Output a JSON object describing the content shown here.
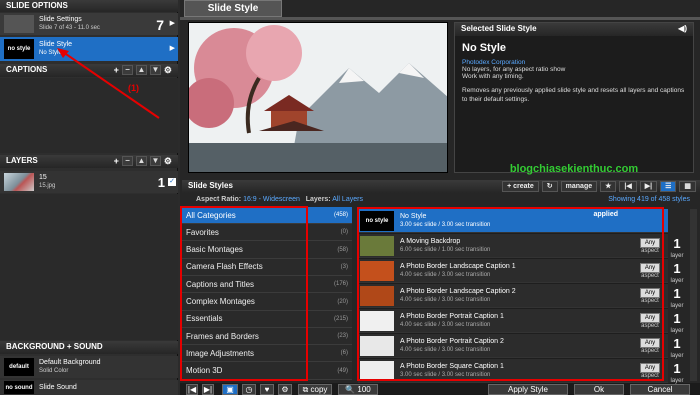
{
  "left": {
    "slide_options_title": "SLIDE OPTIONS",
    "slide_settings": {
      "title": "Slide Settings",
      "sub": "Slide 7 of 43 - 11.0 sec",
      "count": "7"
    },
    "selected_style": {
      "thumb": "no style",
      "title": "Slide Style",
      "sub": "No Style"
    },
    "captions_title": "CAPTIONS",
    "annotation": "(1)",
    "layers_title": "LAYERS",
    "layer": {
      "name": "15",
      "file": "15.jpg",
      "count": "1"
    },
    "bg_sound_title": "BACKGROUND + SOUND",
    "background": {
      "thumb": "default",
      "title": "Default Background",
      "sub": "Solid Color"
    },
    "sound": {
      "thumb": "no sound",
      "title": "Slide Sound"
    }
  },
  "tab": {
    "label": "Slide Style"
  },
  "selected_panel": {
    "title": "Selected Slide Style",
    "name": "No Style",
    "author": "Photodex Corporation",
    "desc1": "No layers, for any aspect ratio show",
    "desc2": "Work with any timing.",
    "desc3": "Removes any previously applied slide style and resets all layers and captions to their default settings."
  },
  "watermark": "blogchiasekienthuc.com",
  "styles": {
    "title": "Slide Styles",
    "create_label": "create",
    "manage_label": "manage",
    "aspect_label": "Aspect Ratio:",
    "aspect_value": "16:9 - Widescreen",
    "layers_label": "Layers:",
    "layers_value": "All Layers",
    "showing": "Showing 419 of 458 styles"
  },
  "categories": [
    {
      "name": "All Categories",
      "count": "(458)"
    },
    {
      "name": "Favorites",
      "count": "(0)"
    },
    {
      "name": "Basic Montages",
      "count": "(58)"
    },
    {
      "name": "Camera Flash Effects",
      "count": "(3)"
    },
    {
      "name": "Captions and Titles",
      "count": "(176)"
    },
    {
      "name": "Complex Montages",
      "count": "(20)"
    },
    {
      "name": "Essentials",
      "count": "(215)"
    },
    {
      "name": "Frames and Borders",
      "count": "(23)"
    },
    {
      "name": "Image Adjustments",
      "count": "(6)"
    },
    {
      "name": "Motion 3D",
      "count": "(49)"
    }
  ],
  "style_items": [
    {
      "thumb": "no style",
      "name": "No Style",
      "timing": "3.00 sec slide / 3.00 sec transition",
      "status": "applied"
    },
    {
      "name": "A Moving Backdrop",
      "timing": "6.00 sec slide / 1.00 sec transition",
      "aspect": "Any",
      "aspect_sub": "aspect",
      "layers": "1",
      "layers_label": "layer"
    },
    {
      "name": "A Photo Border Landscape Caption 1",
      "timing": "4.00 sec slide / 3.00 sec transition",
      "aspect": "Any",
      "aspect_sub": "aspect",
      "layers": "1",
      "layers_label": "layer"
    },
    {
      "name": "A Photo Border Landscape Caption 2",
      "timing": "4.00 sec slide / 3.00 sec transition",
      "aspect": "Any",
      "aspect_sub": "aspect",
      "layers": "1",
      "layers_label": "layer"
    },
    {
      "name": "A Photo Border Portrait Caption 1",
      "timing": "4.00 sec slide / 3.00 sec transition",
      "aspect": "Any",
      "aspect_sub": "aspect",
      "layers": "1",
      "layers_label": "layer"
    },
    {
      "name": "A Photo Border Portrait Caption 2",
      "timing": "4.00 sec slide / 3.00 sec transition",
      "aspect": "Any",
      "aspect_sub": "aspect",
      "layers": "1",
      "layers_label": "layer"
    },
    {
      "name": "A Photo Border Square Caption 1",
      "timing": "3.00 sec slide / 3.00 sec transition",
      "aspect": "Any",
      "aspect_sub": "aspect",
      "layers": "1",
      "layers_label": "layer"
    }
  ],
  "bottom": {
    "copy_label": "copy",
    "zoom": "100",
    "apply_label": "Apply Style",
    "ok_label": "Ok",
    "cancel_label": "Cancel"
  },
  "colors": {
    "accent": "#1f6fc5",
    "annotation_red": "#e60000",
    "watermark_green": "#33cc33"
  }
}
